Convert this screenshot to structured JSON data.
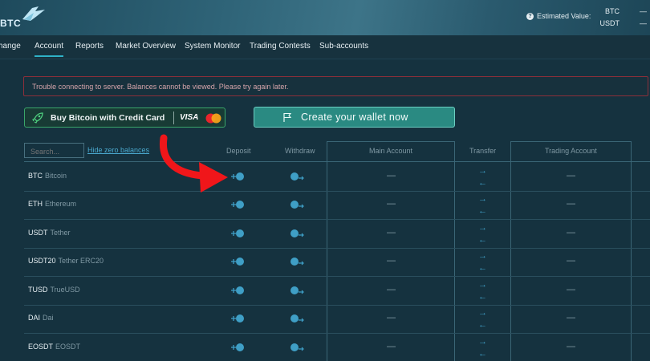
{
  "header": {
    "logo_text": "BTC",
    "estimated_label": "Estimated Value:",
    "currencies": [
      {
        "code": "BTC",
        "value": "—"
      },
      {
        "code": "USDT",
        "value": "—"
      }
    ]
  },
  "nav": {
    "items": [
      {
        "label": "hange",
        "active": false
      },
      {
        "label": "Account",
        "active": true
      },
      {
        "label": "Reports",
        "active": false
      },
      {
        "label": "Market Overview",
        "active": false
      },
      {
        "label": "System Monitor",
        "active": false
      },
      {
        "label": "Trading Contests",
        "active": false
      },
      {
        "label": "Sub-accounts",
        "active": false
      }
    ]
  },
  "alert": {
    "text": "Trouble connecting to server. Balances cannot be viewed. Please try again later."
  },
  "buy_button": {
    "label": "Buy Bitcoin with Credit Card",
    "visa": "VISA"
  },
  "wallet_button": {
    "label": "Create your wallet now"
  },
  "table": {
    "search_placeholder": "Search...",
    "hide_zero_label": "Hide zero balances",
    "columns": {
      "deposit": "Deposit",
      "withdraw": "Withdraw",
      "main": "Main Account",
      "transfer": "Transfer",
      "trading": "Trading Account"
    },
    "empty_value": "—",
    "transfer_right": "→",
    "transfer_left": "←",
    "rows": [
      {
        "symbol": "BTC",
        "name": "Bitcoin"
      },
      {
        "symbol": "ETH",
        "name": "Ethereum"
      },
      {
        "symbol": "USDT",
        "name": "Tether"
      },
      {
        "symbol": "USDT20",
        "name": "Tether ERC20"
      },
      {
        "symbol": "TUSD",
        "name": "TrueUSD"
      },
      {
        "symbol": "DAI",
        "name": "Dai"
      },
      {
        "symbol": "EOSDT",
        "name": "EOSDT"
      }
    ]
  },
  "colors": {
    "accent": "#2fb3c8",
    "alert_border": "#8c2f3a",
    "buy_border": "#3aa66a",
    "wallet_bg": "#2a8a82",
    "annotation_arrow": "#f0161a"
  }
}
